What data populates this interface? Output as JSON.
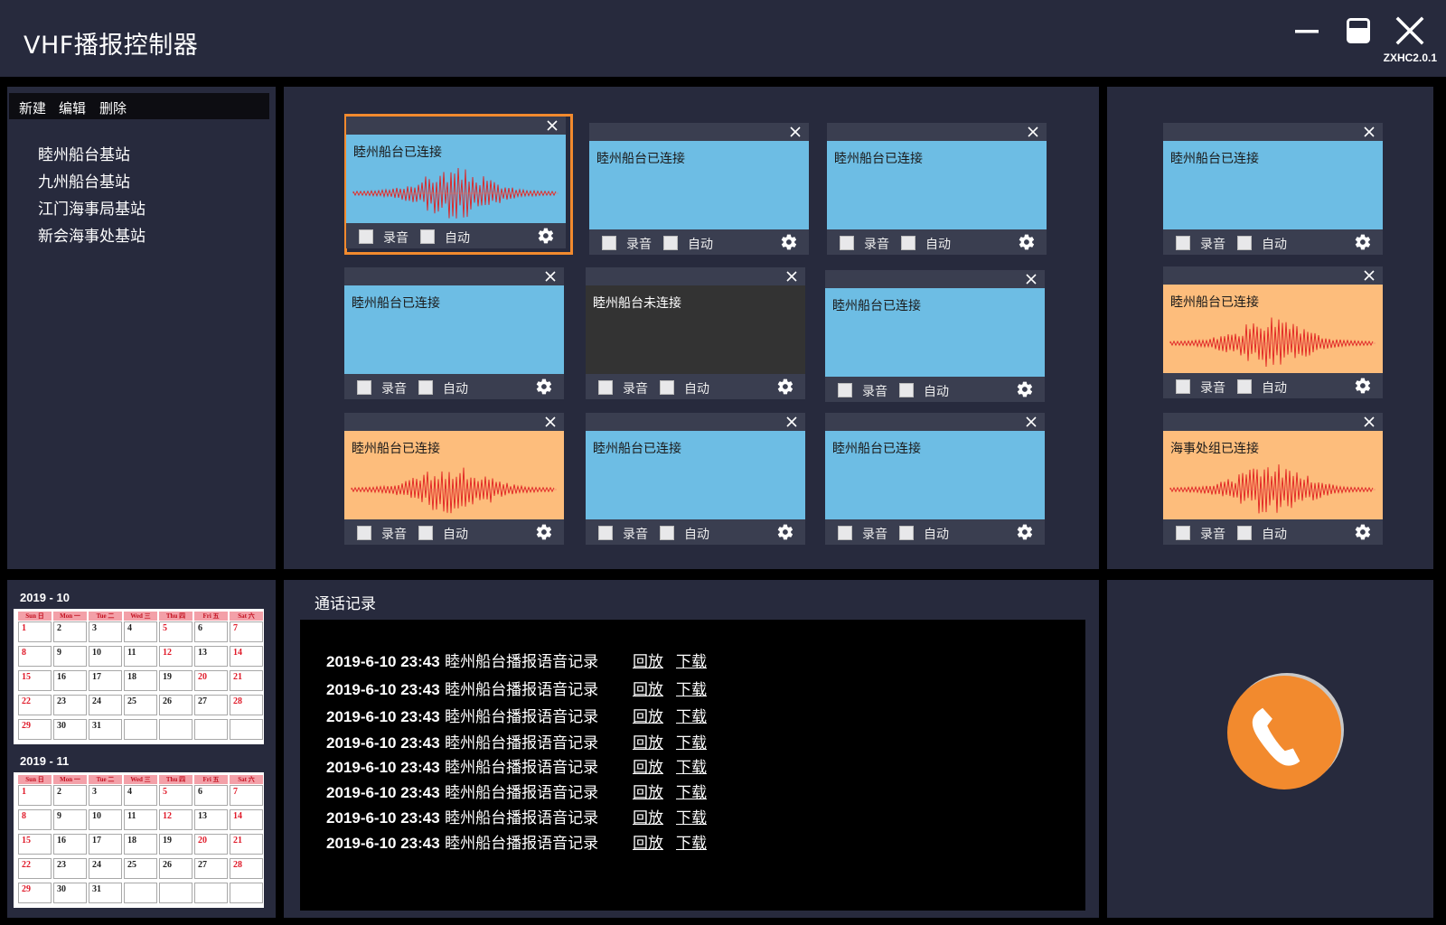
{
  "header": {
    "title": "VHF播报控制器",
    "version": "ZXHC2.0.1"
  },
  "toolbar": {
    "new": "新建",
    "edit": "编辑",
    "delete": "删除"
  },
  "stations": [
    "睦州船台基站",
    "九州船台基站",
    "江门海事局基站",
    "新会海事处基站"
  ],
  "labels": {
    "record": "录音",
    "auto": "自动"
  },
  "cards": [
    {
      "status": "睦州船台已连接",
      "state": "connected",
      "wave": true,
      "selected": true
    },
    {
      "status": "睦州船台已连接",
      "state": "connected",
      "wave": false
    },
    {
      "status": "睦州船台已连接",
      "state": "connected",
      "wave": false
    },
    {
      "status": "睦州船台已连接",
      "state": "connected",
      "wave": false
    },
    {
      "status": "睦州船台已连接",
      "state": "connected",
      "wave": false
    },
    {
      "status": "睦州船台未连接",
      "state": "disconnected",
      "wave": false
    },
    {
      "status": "睦州船台已连接",
      "state": "connected",
      "wave": false
    },
    {
      "status": "睦州船台已连接",
      "state": "active",
      "wave": true
    },
    {
      "status": "睦州船台已连接",
      "state": "active",
      "wave": true
    },
    {
      "status": "睦州船台已连接",
      "state": "connected",
      "wave": false
    },
    {
      "status": "睦州船台已连接",
      "state": "connected",
      "wave": false
    },
    {
      "status": "海事处组已连接",
      "state": "active",
      "wave": true
    }
  ],
  "calendar": {
    "weekdays": [
      "Sun 日",
      "Mon 一",
      "Tue 二",
      "Wed 三",
      "Thu 四",
      "Fri 五",
      "Sat 六"
    ],
    "months": [
      {
        "title": "2019 - 10",
        "start_weekday": 0,
        "days": 31,
        "red_days": [
          1,
          5,
          7,
          8,
          12,
          14,
          15,
          20,
          21,
          22,
          28,
          29
        ]
      },
      {
        "title": "2019 - 11",
        "start_weekday": 0,
        "days": 31,
        "red_days": [
          1,
          5,
          7,
          8,
          12,
          14,
          15,
          20,
          21,
          22,
          28,
          29
        ]
      }
    ]
  },
  "call_log": {
    "title": "通话记录",
    "play_label": "回放",
    "download_label": "下载",
    "entries": [
      {
        "time": "2019-6-10 23:43",
        "desc": "睦州船台播报语音记录"
      },
      {
        "time": "2019-6-10 23:43",
        "desc": "睦州船台播报语音记录"
      },
      {
        "time": "2019-6-10 23:43",
        "desc": "睦州船台播报语音记录"
      },
      {
        "time": "2019-6-10 23:43",
        "desc": "睦州船台播报语音记录"
      },
      {
        "time": "2019-6-10 23:43",
        "desc": "睦州船台播报语音记录"
      },
      {
        "time": "2019-6-10 23:43",
        "desc": "睦州船台播报语音记录"
      },
      {
        "time": "2019-6-10 23:43",
        "desc": "睦州船台播报语音记录"
      },
      {
        "time": "2019-6-10 23:43",
        "desc": "睦州船台播报语音记录"
      }
    ]
  },
  "icons": {
    "minimize": "minimize-icon",
    "restore": "restore-icon",
    "close": "close-icon",
    "settings": "gear-icon",
    "call": "phone-icon"
  },
  "colors": {
    "accent": "#f28a2e",
    "connected": "#6dbde4",
    "active": "#fdbd7c",
    "disconnected": "#333333",
    "wave": "#e02020"
  }
}
